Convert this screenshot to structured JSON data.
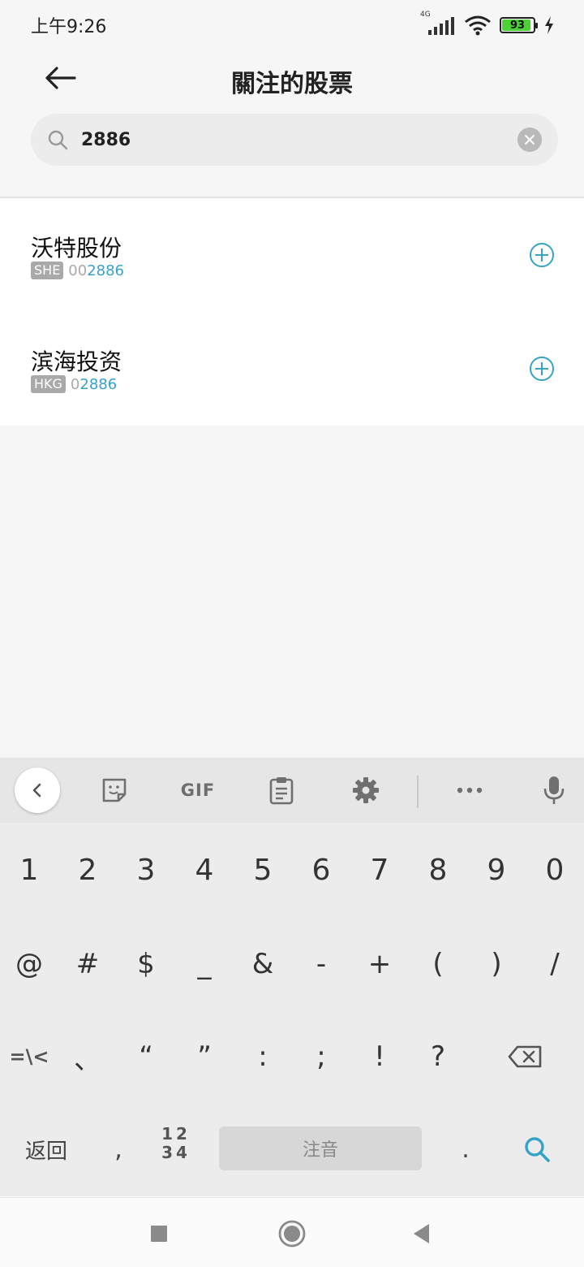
{
  "status": {
    "time": "上午9:26",
    "network": "4G",
    "battery": "93",
    "battery_level": 0.93
  },
  "header": {
    "title": "關注的股票"
  },
  "search": {
    "value": "2886",
    "placeholder": ""
  },
  "results": [
    {
      "name": "沃特股份",
      "exchange": "SHE",
      "code_prefix": "00",
      "code_match": "2886"
    },
    {
      "name": "滨海投资",
      "exchange": "HKG",
      "code_prefix": "0",
      "code_match": "2886"
    }
  ],
  "keyboard": {
    "toolbar": {
      "gif": "GIF"
    },
    "row1": [
      "1",
      "2",
      "3",
      "4",
      "5",
      "6",
      "7",
      "8",
      "9",
      "0"
    ],
    "row2": [
      "@",
      "#",
      "$",
      "_",
      "&",
      "-",
      "+",
      "(",
      ")",
      "/"
    ],
    "row3": [
      "=\\<",
      "、",
      "“",
      "”",
      ":",
      ";",
      "!",
      "?"
    ],
    "row4": {
      "back": "返回",
      "comma": ",",
      "numbers_top": "12",
      "numbers_bottom": "34",
      "space": "注音",
      "period": "."
    }
  },
  "colors": {
    "accent": "#36a3c6",
    "battery_fill": "#4cd137"
  }
}
